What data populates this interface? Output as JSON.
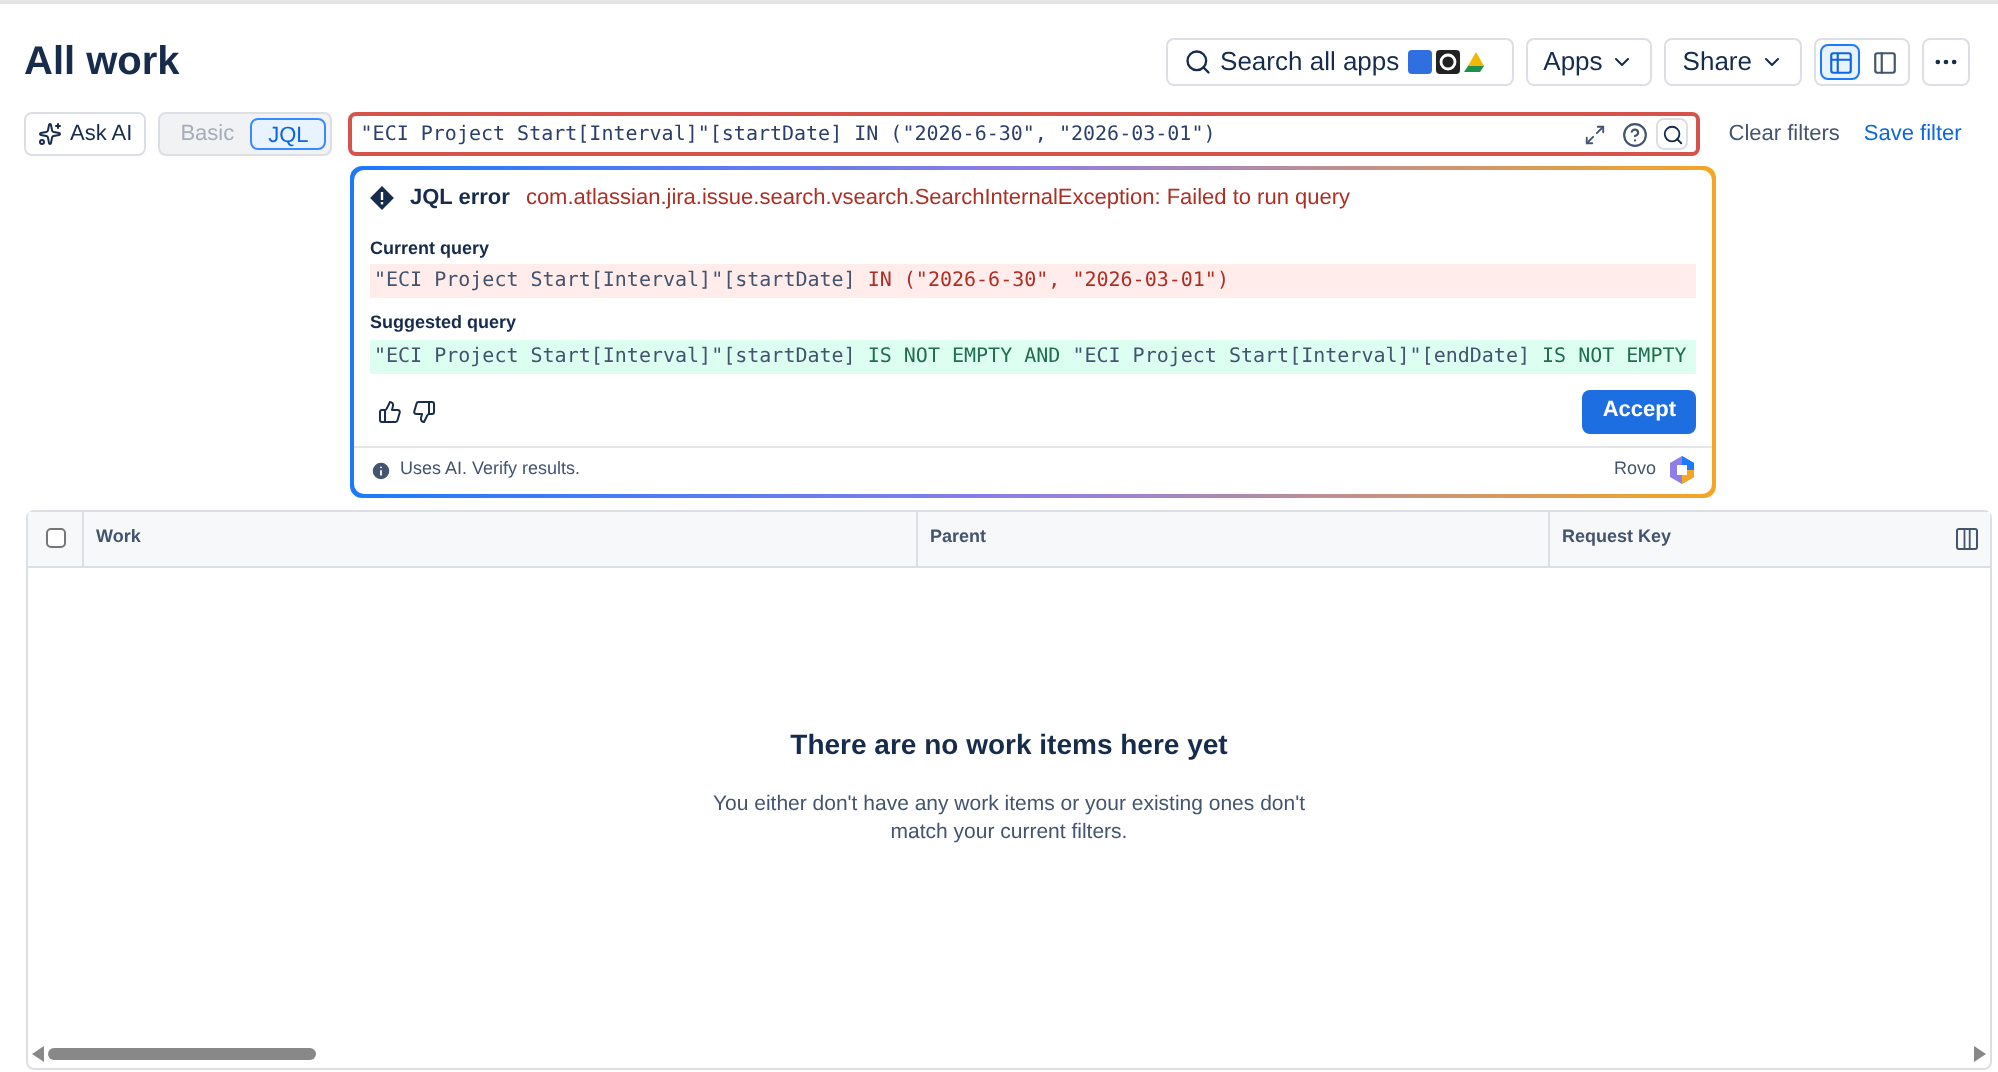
{
  "page_title": "All work",
  "header_actions": {
    "search_label": "Search all apps",
    "apps": "Apps",
    "share": "Share",
    "view_modes": [
      {
        "kind": "list",
        "selected": true
      },
      {
        "kind": "detail",
        "selected": false
      }
    ]
  },
  "ask_ai": "Ask AI",
  "mode_toggle": [
    {
      "label": "Basic",
      "selected": false
    },
    {
      "label": "JQL",
      "selected": true
    }
  ],
  "query": {
    "value": "\"ECI Project Start[Interval]\"[startDate] IN (\"2026-6-30\", \"2026-03-01\")",
    "error": true
  },
  "clear_filters": "Clear filters",
  "save_filter": "Save filter",
  "jql_error": {
    "title": "JQL error",
    "message": "com.atlassian.jira.issue.search.vsearch.SearchInternalException: Failed to run query",
    "current_label": "Current query",
    "current_query": [
      {
        "text": "\"ECI Project Start[Interval]\"[startDate] ",
        "kind": "field"
      },
      {
        "text": "IN (\"2026-6-30\", \"2026-03-01\")",
        "kind": "removed"
      }
    ],
    "suggested_label": "Suggested query",
    "suggested_query": [
      {
        "text": "\"ECI Project Start[Interval]\"[startDate] ",
        "kind": "field"
      },
      {
        "text": "IS NOT EMPTY AND ",
        "kind": "added"
      },
      {
        "text": "\"ECI Project Start[Interval]\"[endDate] ",
        "kind": "field"
      },
      {
        "text": "IS NOT EMPTY",
        "kind": "added"
      }
    ],
    "accept": "Accept",
    "disclaimer": "Uses AI. Verify results.",
    "brand": "Rovo"
  },
  "table": {
    "columns": [
      "Work",
      "Parent",
      "Request Key"
    ],
    "select_all_checked": false,
    "empty_title": "There are no work items here yet",
    "empty_message": "You either don't have any work items or your existing ones don't match your current filters."
  }
}
